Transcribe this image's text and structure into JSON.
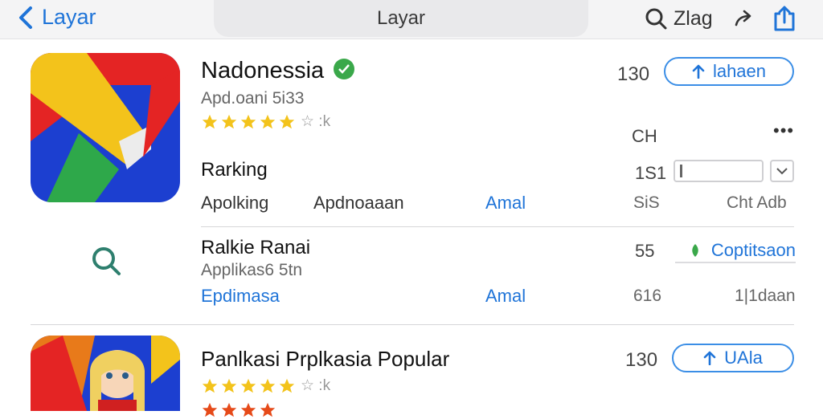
{
  "nav": {
    "back_label": "Layar",
    "title": "Layar",
    "right_label": "Zlag"
  },
  "app1": {
    "name": "Nadonessia",
    "subtitle": "Apd.oani 5i33",
    "install_count": "130",
    "install_label": "lahaen",
    "more_label": "•••",
    "ch_label": "CH",
    "rating": 4,
    "rating_count_label": "☆ :k"
  },
  "section1": {
    "title": "Rarking",
    "count": "1S1",
    "col_a": "Apolking",
    "col_b": "Apdnoaaan",
    "col_c": "Amal",
    "col_d": "SiS",
    "col_e": "Cht Adb"
  },
  "section2": {
    "title": "Ralkie Ranai",
    "subtitle": "Applikas6 5tn",
    "count": "55",
    "copt_label": "Coptitsaon",
    "link": "Epdimasa",
    "col_c": "Amal",
    "col_d": "616",
    "col_e": "1|1daan"
  },
  "app2": {
    "name": "Panlkasi Prplkasia Popular",
    "install_count": "130",
    "install_label": "UAla",
    "rating": 4,
    "rating_count_label": "☆ :k"
  },
  "colors": {
    "accent": "#1f74d8",
    "star": "#f3c31b",
    "badge": "#3aa84a"
  }
}
